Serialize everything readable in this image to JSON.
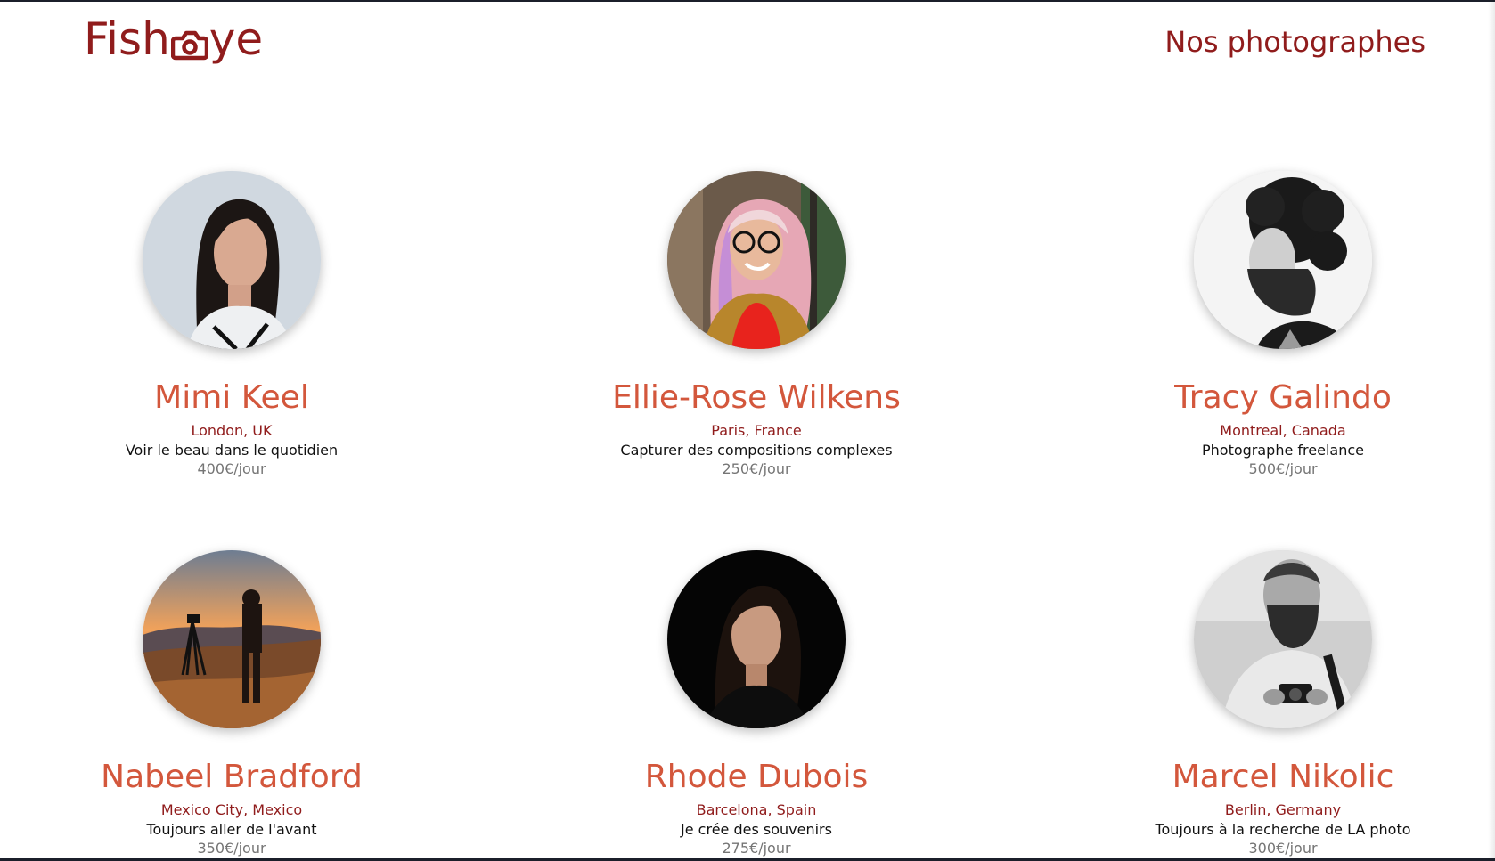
{
  "header": {
    "logo_before": "Fish",
    "logo_after": "ye",
    "logo_icon": "camera-icon",
    "heading": "Nos photographes"
  },
  "colors": {
    "brand": "#901c1c",
    "name": "#d3573c",
    "tagline": "#111111",
    "price": "#757575"
  },
  "photographers": [
    {
      "name": "Mimi Keel",
      "location": "London, UK",
      "tagline": "Voir le beau dans le quotidien",
      "price": "400€/jour"
    },
    {
      "name": "Ellie-Rose Wilkens",
      "location": "Paris, France",
      "tagline": "Capturer des compositions complexes",
      "price": "250€/jour"
    },
    {
      "name": "Tracy Galindo",
      "location": "Montreal, Canada",
      "tagline": "Photographe freelance",
      "price": "500€/jour"
    },
    {
      "name": "Nabeel Bradford",
      "location": "Mexico City, Mexico",
      "tagline": "Toujours aller de l'avant",
      "price": "350€/jour"
    },
    {
      "name": "Rhode Dubois",
      "location": "Barcelona, Spain",
      "tagline": "Je crée des souvenirs",
      "price": "275€/jour"
    },
    {
      "name": "Marcel Nikolic",
      "location": "Berlin, Germany",
      "tagline": "Toujours à la recherche de LA photo",
      "price": "300€/jour"
    }
  ]
}
